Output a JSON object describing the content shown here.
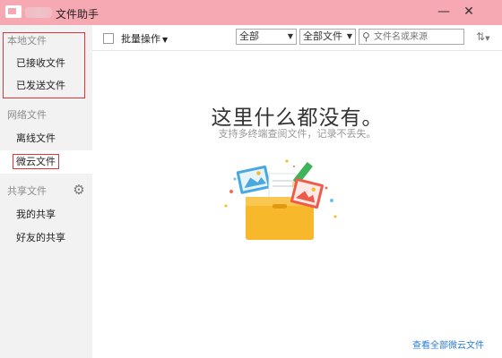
{
  "window": {
    "title": "文件助手",
    "minimize_glyph": "—",
    "close_glyph": "✕"
  },
  "sidebar": {
    "local_header": "本地文件",
    "local_items": [
      {
        "label": "已接收文件"
      },
      {
        "label": "已发送文件"
      }
    ],
    "network_header": "网络文件",
    "network_items": [
      {
        "label": "离线文件"
      },
      {
        "label": "微云文件",
        "selected": true
      }
    ],
    "shared_header": "共享文件",
    "shared_items": [
      {
        "label": "我的共享"
      },
      {
        "label": "好友的共享"
      }
    ]
  },
  "toolbar": {
    "batch_label": "批量操作",
    "filter_type": "全部",
    "filter_category": "全部文件",
    "search_placeholder": "文件名或来源"
  },
  "empty_state": {
    "title": "这里什么都没有。",
    "subtitle": "支持多终端查阅文件，记录不丢失。"
  },
  "footer": {
    "link_label": "查看全部微云文件"
  },
  "colors": {
    "titlebar": "#f6a8b3",
    "sidebar_bg": "#f2f2f2",
    "highlight_border": "#e0333a",
    "link": "#2a7cd6",
    "folder": "#f7b82b"
  }
}
